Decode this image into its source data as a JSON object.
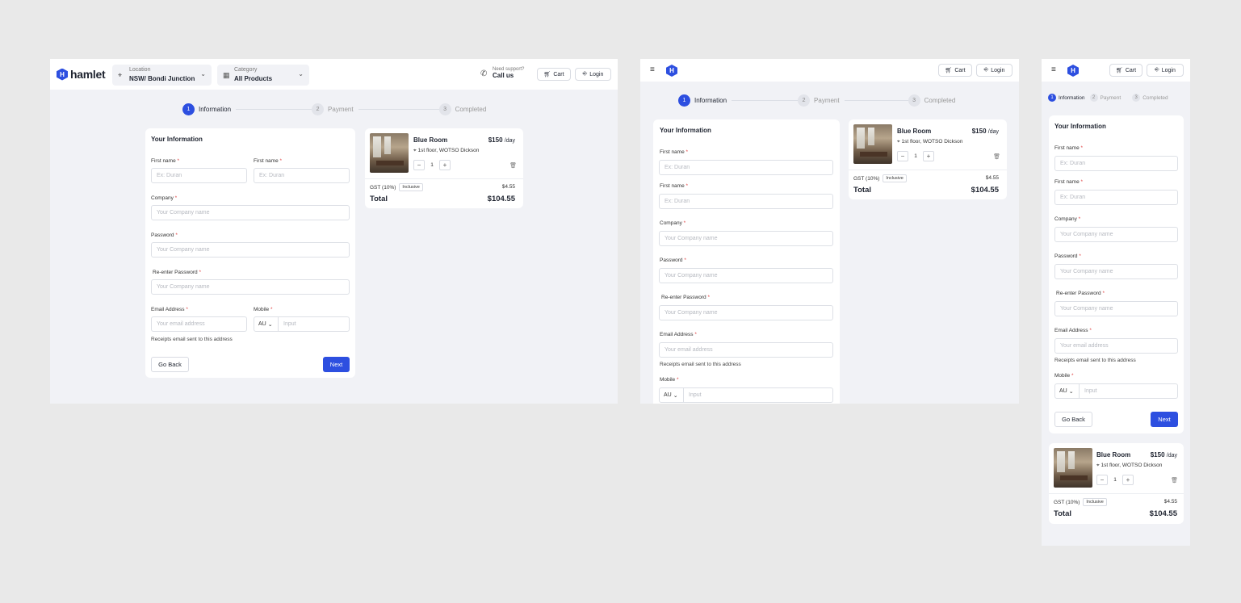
{
  "brand": {
    "name": "hamlet",
    "icon": "hexagon-h-logo"
  },
  "header": {
    "location_label": "Location",
    "location_value": "NSW/ Bondi Junction",
    "category_label": "Category",
    "category_value": "All Products",
    "support_label": "Need support?",
    "support_action": "Call us",
    "cart_label": "Cart",
    "login_label": "Login"
  },
  "steps": [
    {
      "num": "1",
      "label": "Information",
      "active": true
    },
    {
      "num": "2",
      "label": "Payment",
      "active": false
    },
    {
      "num": "3",
      "label": "Completed",
      "active": false
    }
  ],
  "form": {
    "title": "Your Information",
    "first_name_label": "First name",
    "first_name_placeholder": "Ex: Duran",
    "company_label": "Company",
    "company_placeholder": "Your Company name",
    "password_label": "Password",
    "password_placeholder": "Your Company name",
    "reenter_label": "Re-enter Password",
    "reenter_placeholder": "Your Company name",
    "email_label": "Email Address",
    "email_placeholder": "Your email address",
    "mobile_label": "Mobile",
    "mobile_country": "AU",
    "mobile_placeholder": "Input",
    "email_hint": "Receipts email sent to this address",
    "required_mark": "*",
    "back_label": "Go Back",
    "next_label": "Next"
  },
  "cart": {
    "product_name": "Blue Room",
    "price": "$150",
    "price_unit": "/day",
    "location": "1st floor, WOTSO Dickson",
    "quantity": "1",
    "gst_label": "GST (10%)",
    "gst_badge": "Inclusive",
    "gst_value": "$4.55",
    "total_label": "Total",
    "total_value": "$104.55"
  },
  "colors": {
    "accent": "#2d4fe0",
    "required": "#e04646",
    "page_bg": "#f1f2f6",
    "canvas_bg": "#e9e9e9"
  }
}
